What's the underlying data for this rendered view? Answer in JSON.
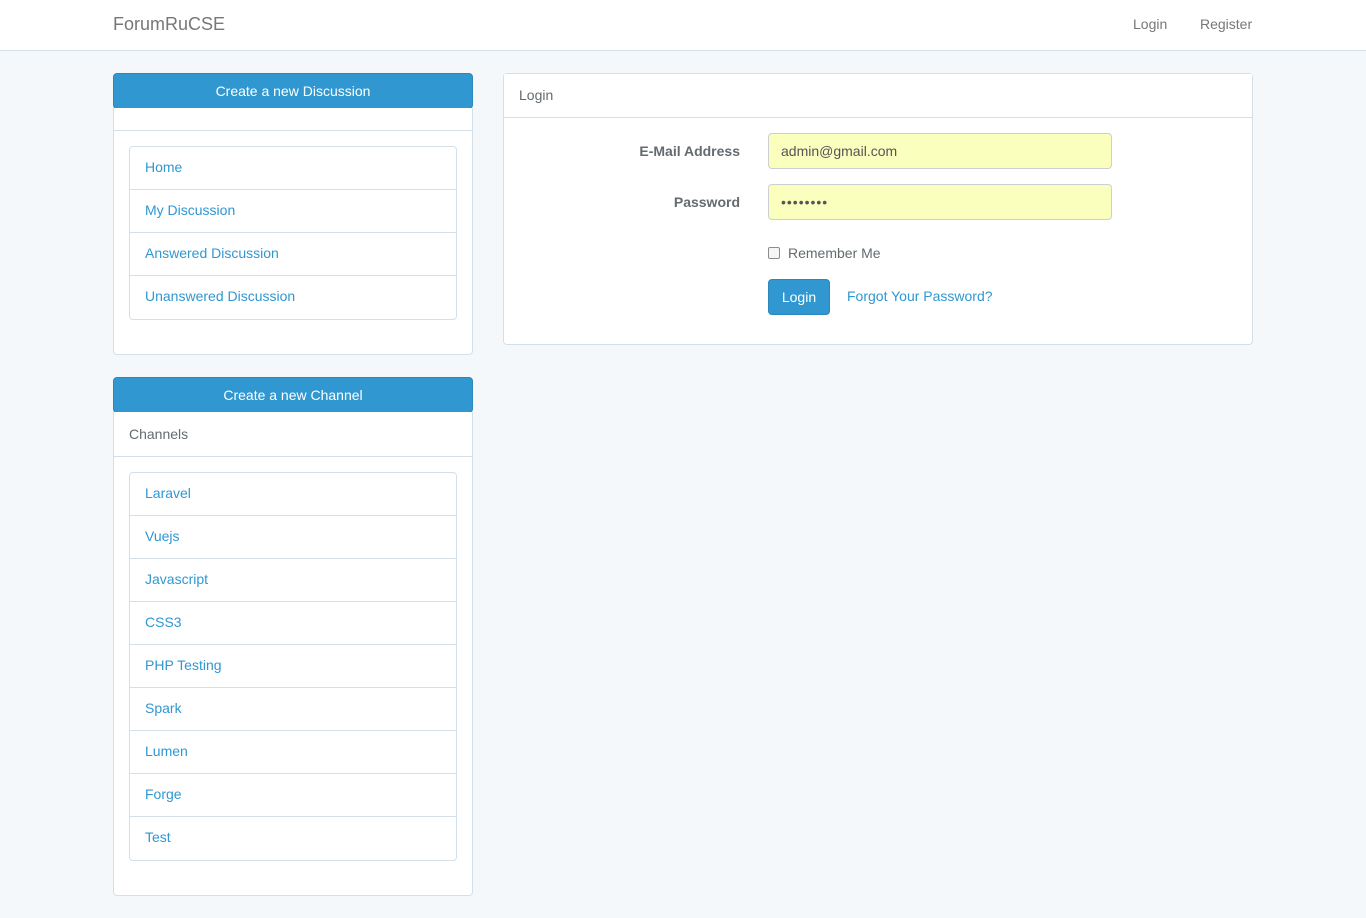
{
  "navbar": {
    "brand": "ForumRuCSE",
    "login": "Login",
    "register": "Register"
  },
  "sidebar": {
    "create_discussion_label": "Create a new Discussion",
    "discussion_links": [
      {
        "label": "Home"
      },
      {
        "label": "My Discussion"
      },
      {
        "label": "Answered Discussion"
      },
      {
        "label": "Unanswered Discussion"
      }
    ],
    "create_channel_label": "Create a new Channel",
    "channels_heading": "Channels",
    "channels": [
      {
        "label": "Laravel"
      },
      {
        "label": "Vuejs"
      },
      {
        "label": "Javascript"
      },
      {
        "label": "CSS3"
      },
      {
        "label": "PHP Testing"
      },
      {
        "label": "Spark"
      },
      {
        "label": "Lumen"
      },
      {
        "label": "Forge"
      },
      {
        "label": "Test"
      }
    ]
  },
  "login_panel": {
    "heading": "Login",
    "email_label": "E-Mail Address",
    "email_value": "admin@gmail.com",
    "password_label": "Password",
    "password_value": "••••••••",
    "remember_label": "Remember Me",
    "remember_checked": false,
    "login_button": "Login",
    "forgot_link": "Forgot Your Password?"
  },
  "colors": {
    "primary": "#3097d1",
    "background": "#f5f8fa",
    "autofill": "#faffbd"
  }
}
